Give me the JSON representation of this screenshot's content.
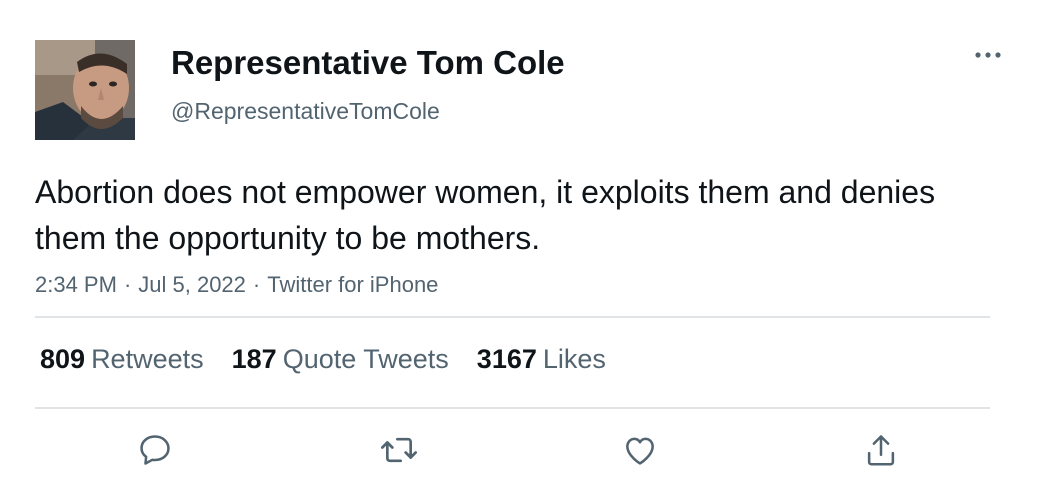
{
  "tweet": {
    "author": {
      "display_name": "Representative Tom Cole",
      "handle": "@RepresentativeTomCole",
      "avatar": "profile-photo"
    },
    "text": "Abortion does not empower women, it exploits them and denies them the opportunity to be mothers.",
    "meta": {
      "time": "2:34 PM",
      "date": "Jul 5, 2022",
      "source": "Twitter for iPhone",
      "separator": "·"
    },
    "stats": {
      "retweets_count": "809",
      "retweets_label": "Retweets",
      "quotes_count": "187",
      "quotes_label": "Quote Tweets",
      "likes_count": "3167",
      "likes_label": "Likes"
    },
    "icons": {
      "more": "more-horizontal-icon",
      "reply": "reply-icon",
      "retweet": "retweet-icon",
      "like": "heart-icon",
      "share": "share-icon"
    },
    "colors": {
      "text_primary": "#0f1419",
      "text_secondary": "#536471",
      "divider": "#e1e4e6"
    }
  }
}
